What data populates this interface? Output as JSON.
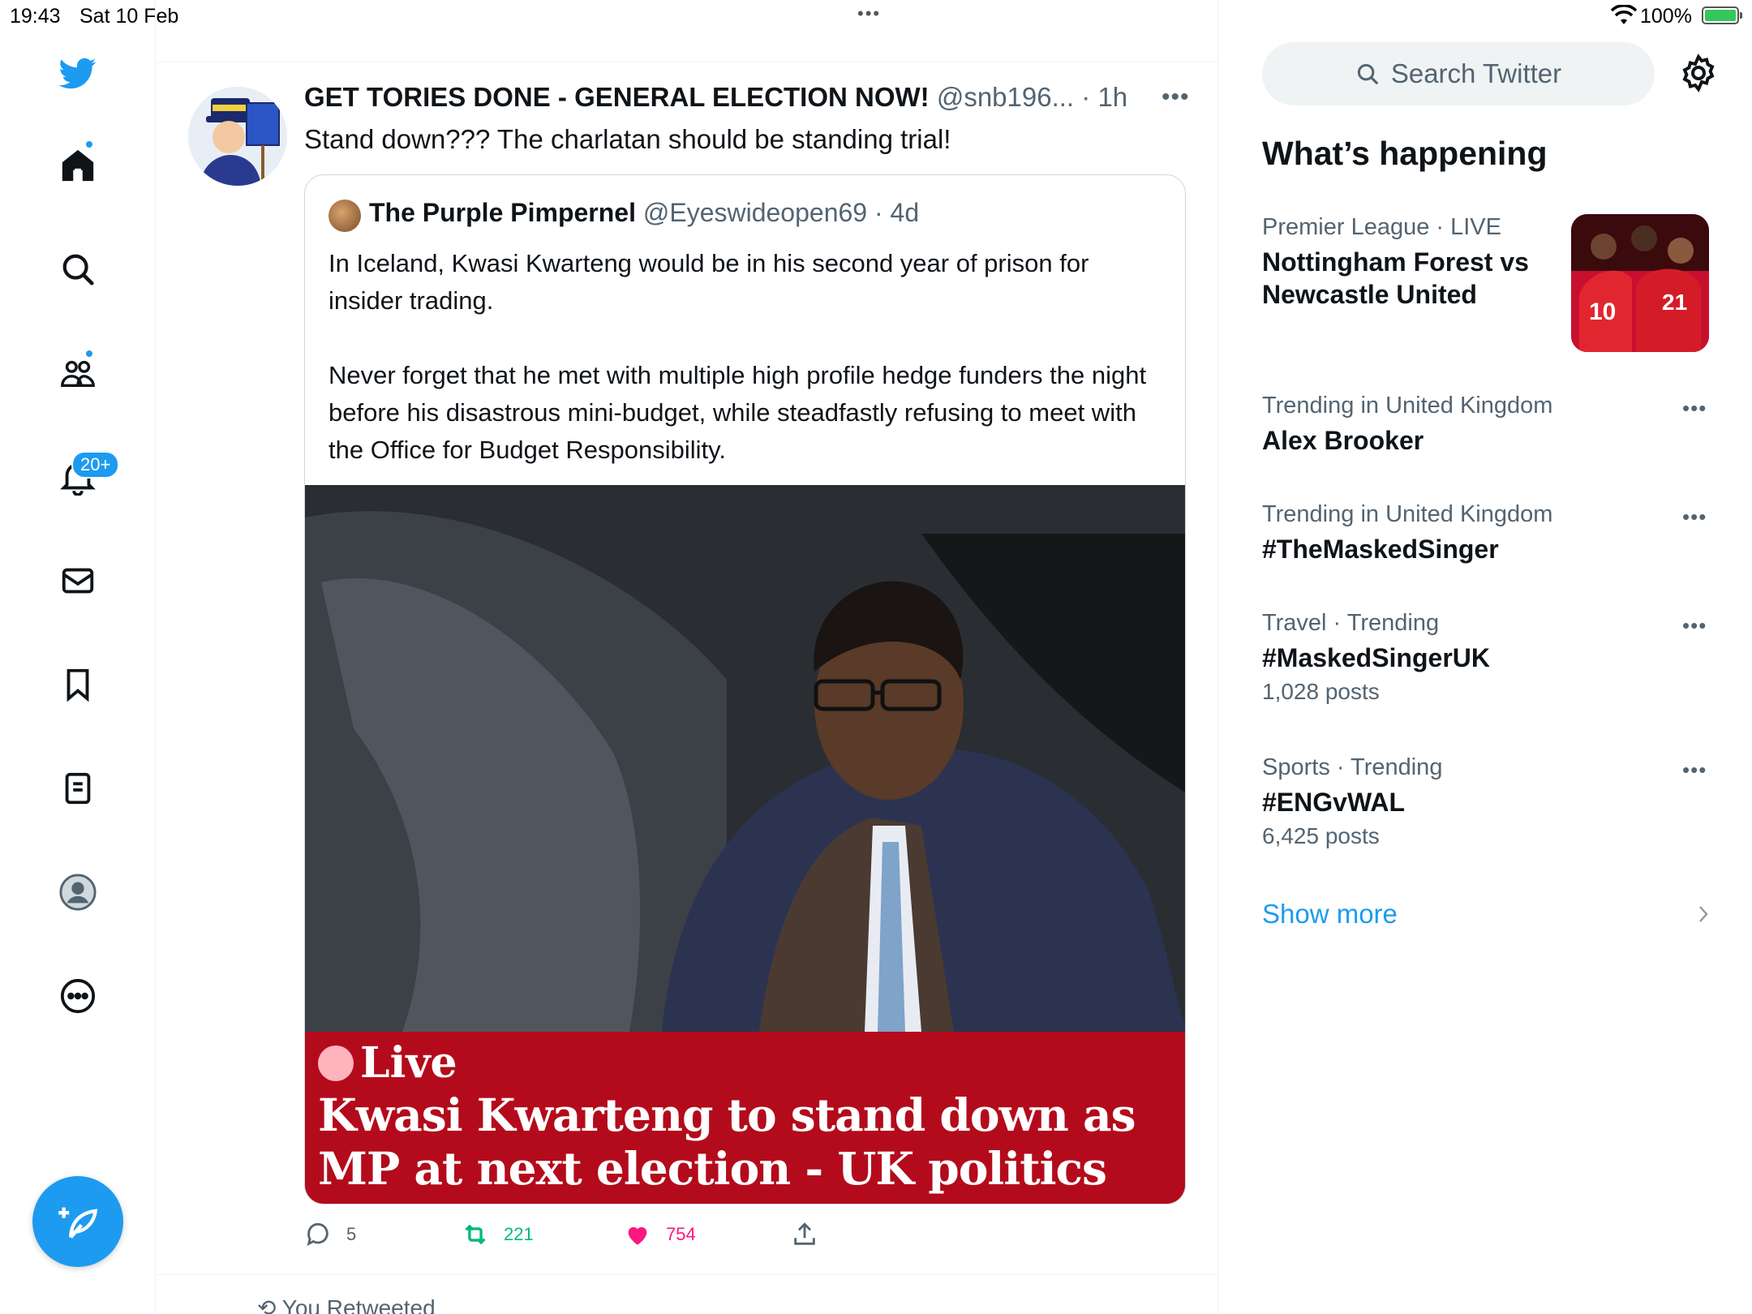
{
  "status_bar": {
    "time": "19:43",
    "date": "Sat 10 Feb",
    "battery": "100%",
    "battery_level": 1.0
  },
  "nav": {
    "notifications_badge": "20+",
    "accent_color": "#1d9bf0"
  },
  "tweet": {
    "author_name": "GET TORIES DONE - GENERAL ELECTION NOW!",
    "author_handle": "@snb196...",
    "time": "· 1h",
    "text": "Stand down??? The charlatan should be standing trial!",
    "quote": {
      "author_name": "The Purple Pimpernel",
      "author_handle": "@Eyeswideopen69",
      "time": "· 4d",
      "text": "In Iceland, Kwasi Kwarteng would be in his second year of prison for insider trading.\n\nNever forget that he met with multiple high profile hedge funders the night before his disastrous mini-budget, while steadfastly refusing to meet with the Office for Budget Responsibility.",
      "image_live_label": "Live",
      "image_headline": "Kwasi Kwarteng to stand down as MP at next election - UK politics live"
    },
    "actions": {
      "replies": "5",
      "retweets": "221",
      "likes": "754"
    },
    "colors": {
      "retweet": "#00ba7c",
      "like": "#f91880",
      "guardian_red": "#b30b1c"
    }
  },
  "next_item": {
    "label": "You Retweeted"
  },
  "sidebar": {
    "search_placeholder": "Search Twitter",
    "title": "What’s happening",
    "trends": [
      {
        "meta": "Premier League · LIVE",
        "topic": "Nottingham Forest vs Newcastle United",
        "posts": ""
      },
      {
        "meta": "Trending in United Kingdom",
        "topic": "Alex Brooker",
        "posts": ""
      },
      {
        "meta": "Trending in United Kingdom",
        "topic": "#TheMaskedSinger",
        "posts": ""
      },
      {
        "meta": "Travel · Trending",
        "topic": "#MaskedSingerUK",
        "posts": "1,028 posts"
      },
      {
        "meta": "Sports · Trending",
        "topic": "#ENGvWAL",
        "posts": "6,425 posts"
      }
    ],
    "show_more": "Show more"
  }
}
